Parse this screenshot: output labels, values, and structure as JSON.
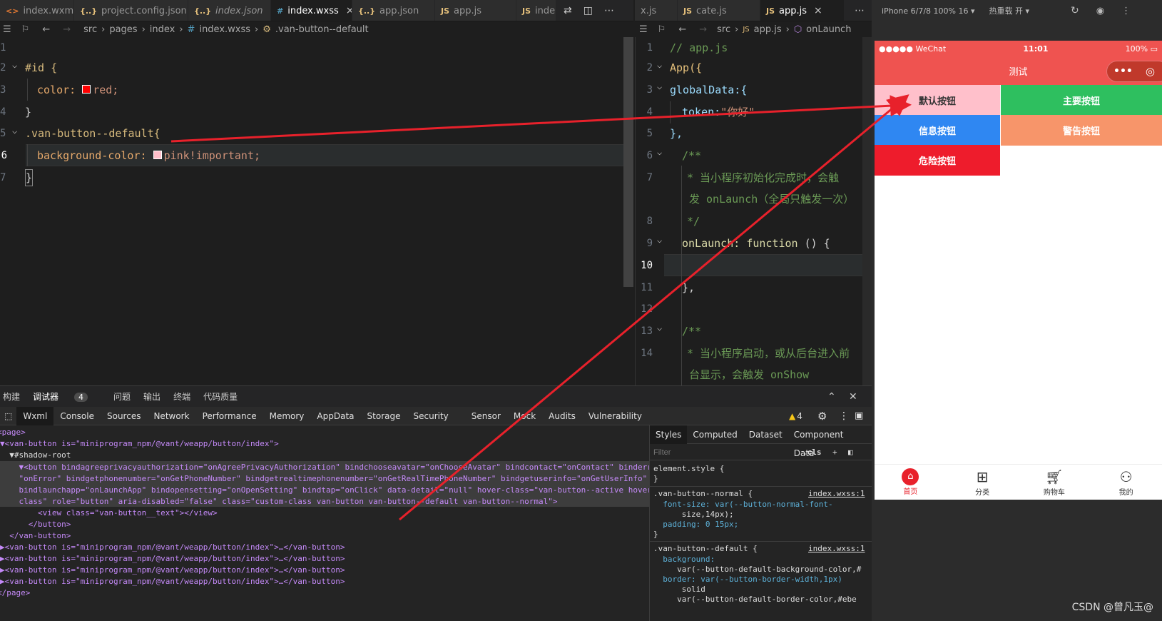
{
  "left_tabs": [
    {
      "label": "index.wxml",
      "icon": "<>",
      "kind": "xml"
    },
    {
      "label": "project.config.json",
      "icon": "{..}",
      "kind": "json"
    },
    {
      "label": "index.json",
      "icon": "{..}",
      "kind": "json",
      "italic": true
    },
    {
      "label": "index.wxss",
      "icon": "#",
      "kind": "css",
      "active": true
    },
    {
      "label": "app.json",
      "icon": "{..}",
      "kind": "json"
    },
    {
      "label": "app.js",
      "icon": "JS",
      "kind": "js"
    },
    {
      "label": "inde:",
      "icon": "JS",
      "kind": "js"
    }
  ],
  "right_tabs": [
    {
      "label": "x.js",
      "icon": "",
      "kind": "js"
    },
    {
      "label": "cate.js",
      "icon": "JS",
      "kind": "js"
    },
    {
      "label": "app.js",
      "icon": "JS",
      "kind": "js",
      "active": true
    }
  ],
  "left_breadcrumb": [
    "src",
    "pages",
    "index",
    "index.wxss",
    ".van-button--default"
  ],
  "right_breadcrumb": [
    "src",
    "app.js",
    "onLaunch"
  ],
  "left_code": {
    "line_numbers": [
      "1",
      "2",
      "3",
      "4",
      "5",
      "6",
      "7"
    ],
    "l2": "#id {",
    "l3_prop": "color:",
    "l3_val": "red;",
    "l4": "}",
    "l5": ".van-button--default{",
    "l6_prop": "background-color:",
    "l6_val": "pink!important;",
    "l7": "}"
  },
  "right_code": {
    "line_numbers": [
      "1",
      "2",
      "3",
      "4",
      "5",
      "6",
      "7",
      "",
      "8",
      "9",
      "10",
      "11",
      "12",
      "13",
      "14"
    ],
    "l1": "// app.js",
    "l2": "App({",
    "l3": "globalData:{",
    "l4_key": "token:",
    "l4_val": "\"你好\"",
    "l5": "},",
    "l6": "/**",
    "l7a": "* 当小程序初始化完成时，会触",
    "l7b": "发 onLaunch（全局只触发一次）",
    "l8": "*/",
    "l9_name": "onLaunch:",
    "l9_kw": "function",
    "l9_rest": "() {",
    "l11": "},",
    "l13": "/**",
    "l14a": "* 当小程序启动，或从后台进入前",
    "l14b": "台显示，会触发 onShow"
  },
  "panel_tabs": [
    "构建",
    "调试器",
    "问题",
    "输出",
    "终端",
    "代码质量"
  ],
  "panel_badge": "4",
  "devtools_tabs": [
    "Wxml",
    "Console",
    "Sources",
    "Network",
    "Performance",
    "Memory",
    "AppData",
    "Storage",
    "Security",
    "Sensor",
    "Mock",
    "Audits",
    "Vulnerability"
  ],
  "warn_count": "4",
  "wxml_lines": [
    "<page>",
    "▼<van-button is=\"miniprogram_npm/@vant/weapp/button/index\">",
    "  ▼#shadow-root",
    "    ▼<button bindagreeprivacyauthorization=\"onAgreePrivacyAuthorization\" bindchooseavatar=\"onChooseAvatar\" bindcontact=\"onContact\" binderror=",
    "    \"onError\" bindgetphonenumber=\"onGetPhoneNumber\" bindgetrealtimephonenumber=\"onGetRealTimePhoneNumber\" bindgetuserinfo=\"onGetUserInfo\"",
    "    bindlaunchapp=\"onLaunchApp\" bindopensetting=\"onOpenSetting\" bindtap=\"onClick\" data-detail=\"null\" hover-class=\"van-button--active hover-",
    "    class\" role=\"button\" aria-disabled=\"false\" class=\"custom-class van-button van-button--default van-button--normal\">",
    "        <view class=\"van-button__text\"></view>",
    "      </button>",
    "  </van-button>",
    "▶<van-button is=\"miniprogram_npm/@vant/weapp/button/index\">…</van-button>",
    "▶<van-button is=\"miniprogram_npm/@vant/weapp/button/index\">…</van-button>",
    "▶<van-button is=\"miniprogram_npm/@vant/weapp/button/index\">…</van-button>",
    "▶<van-button is=\"miniprogram_npm/@vant/weapp/button/index\">…</van-button>",
    "</page>"
  ],
  "styles_tabs": [
    "Styles",
    "Computed",
    "Dataset",
    "Component Data"
  ],
  "styles_filter_placeholder": "Filter",
  "styles_cls": ".cls",
  "style_rules": [
    "element.style {",
    "}",
    ".van-button--normal {",
    "  font-size: var(--button-normal-font-",
    "      size,14px);",
    "  padding: 0 15px;",
    "}",
    ".van-button--default {",
    "  background:",
    "     var(--button-default-background-color,#",
    "  border: var(--button-border-width,1px)",
    "      solid",
    "     var(--button-default-border-color,#ebe"
  ],
  "style_sources": [
    "index.wxss:1",
    "index.wxss:1"
  ],
  "simulator": {
    "device": "iPhone 6/7/8 100% 16 ▾",
    "hot_reload": "热重载 开 ▾",
    "carrier": "●●●●● WeChat",
    "time": "11:01",
    "battery": "100%",
    "page_title": "测试",
    "capsule_dots": "•••",
    "buttons": [
      {
        "label": "默认按钮",
        "bg": "#ffc0cb",
        "fg": "#333333"
      },
      {
        "label": "主要按钮",
        "bg": "#2ebf5f",
        "fg": "#ffffff"
      },
      {
        "label": "信息按钮",
        "bg": "#2f87f2",
        "fg": "#ffffff"
      },
      {
        "label": "警告按钮",
        "bg": "#f7956a",
        "fg": "#ffffff"
      },
      {
        "label": "危险按钮",
        "bg": "#ee1c2c",
        "fg": "#ffffff"
      }
    ],
    "tabbar": [
      {
        "label": "首页",
        "icon": "home-icon",
        "active": true
      },
      {
        "label": "分类",
        "icon": "category-icon"
      },
      {
        "label": "购物车",
        "icon": "cart-icon"
      },
      {
        "label": "我的",
        "icon": "user-icon"
      }
    ]
  },
  "watermark": "CSDN @曾凡玉@",
  "colors": {
    "accent_red": "#e8212b",
    "nav_red": "#ef5350"
  }
}
